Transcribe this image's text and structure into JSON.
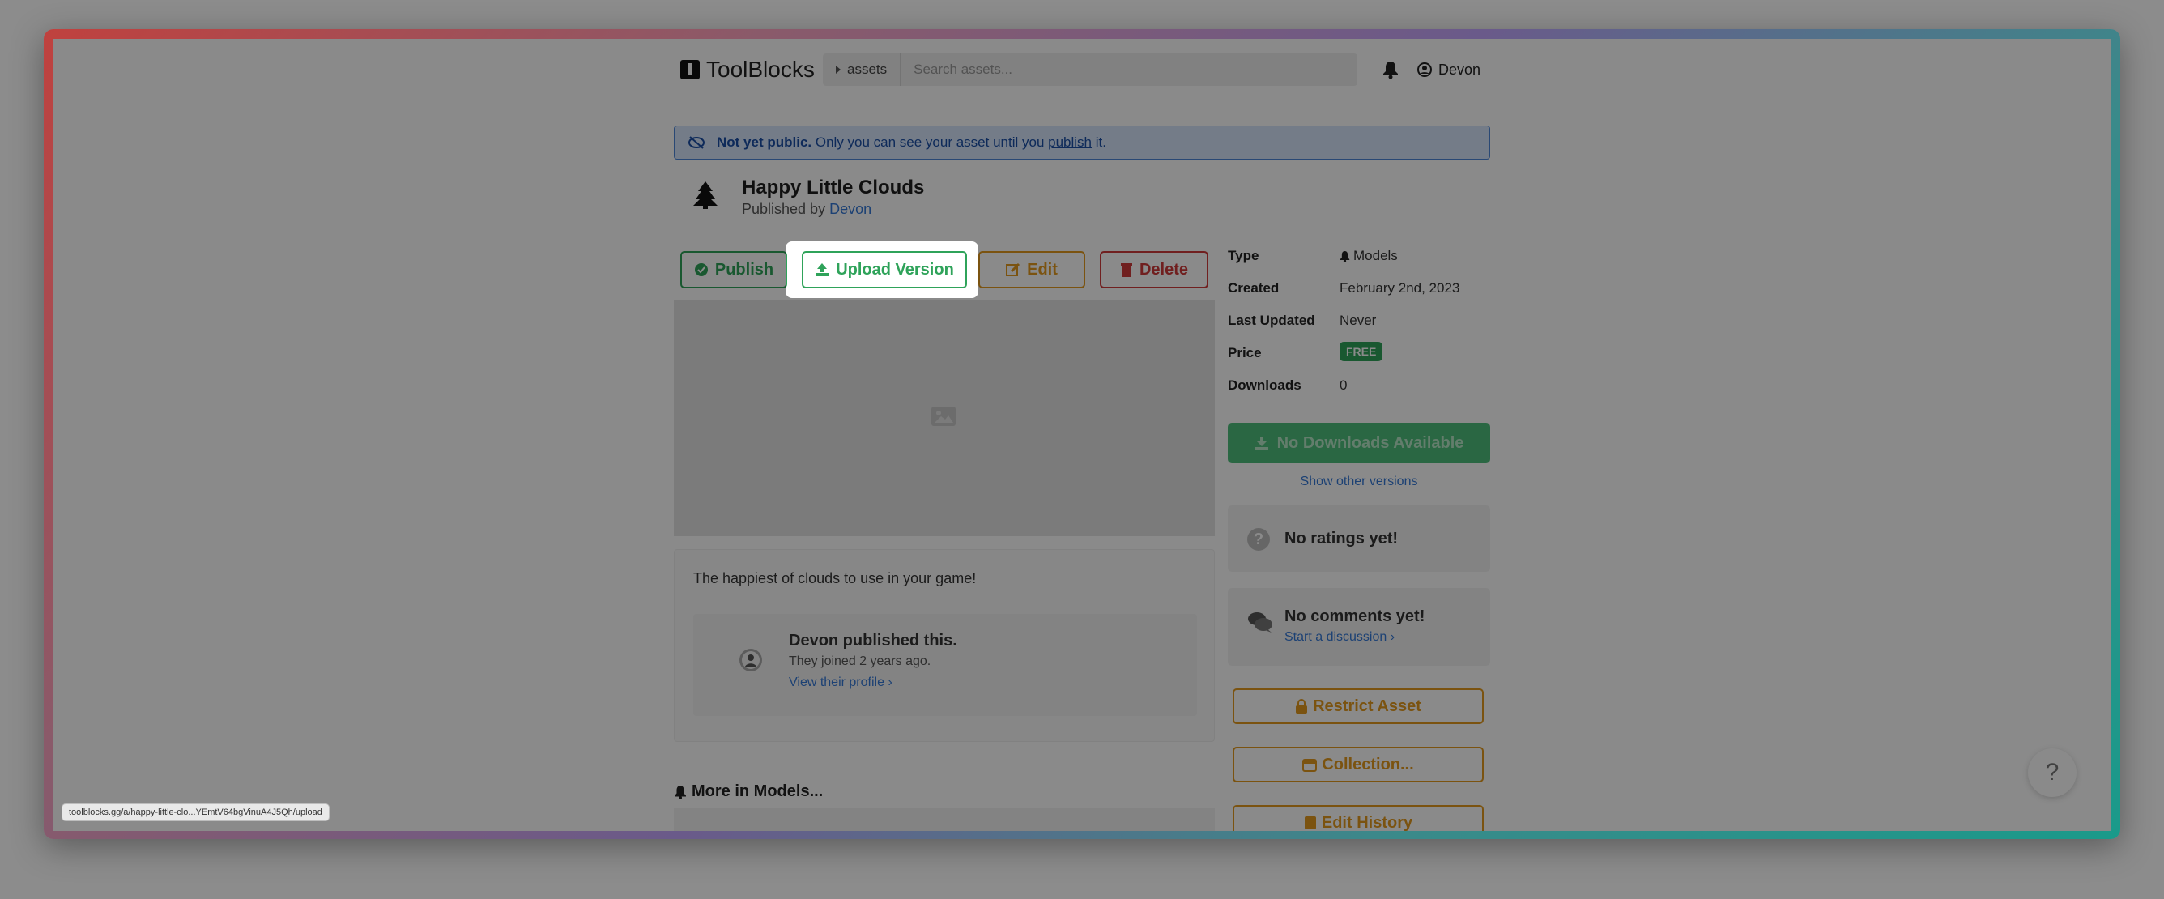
{
  "header": {
    "brand": "ToolBlocks",
    "search_scope": "assets",
    "search_placeholder": "Search assets...",
    "user_name": "Devon"
  },
  "banner": {
    "bold": "Not yet public.",
    "text_before_link": "Only you can see your asset until you",
    "link": "publish",
    "text_after_link": "it."
  },
  "asset": {
    "title": "Happy Little Clouds",
    "published_by_prefix": "Published by",
    "author": "Devon",
    "description": "The happiest of clouds to use in your game!"
  },
  "actions": {
    "publish": "Publish",
    "upload_version": "Upload Version",
    "edit": "Edit",
    "delete": "Delete"
  },
  "publisher": {
    "title": "Devon published this.",
    "joined": "They joined 2 years ago.",
    "profile_link": "View their profile"
  },
  "more": {
    "heading": "More in Models..."
  },
  "meta": {
    "type_label": "Type",
    "type_value": "Models",
    "created_label": "Created",
    "created_value": "February 2nd, 2023",
    "updated_label": "Last Updated",
    "updated_value": "Never",
    "price_label": "Price",
    "price_value": "FREE",
    "downloads_label": "Downloads",
    "downloads_value": "0"
  },
  "download": {
    "button": "No Downloads Available",
    "other_versions": "Show other versions"
  },
  "ratings": {
    "icon": "?",
    "text": "No ratings yet!"
  },
  "comments": {
    "title": "No comments yet!",
    "link": "Start a discussion"
  },
  "side_buttons": {
    "restrict": "Restrict Asset",
    "collection": "Collection...",
    "history": "Edit History"
  },
  "status_url": "toolblocks.gg/a/happy-little-clo...YEmtV64bgVinuA4J5Qh/upload",
  "help": "?",
  "colors": {
    "green": "#2fa35a",
    "orange": "#e39a1f",
    "red": "#d03a3a",
    "link": "#3578d6"
  }
}
